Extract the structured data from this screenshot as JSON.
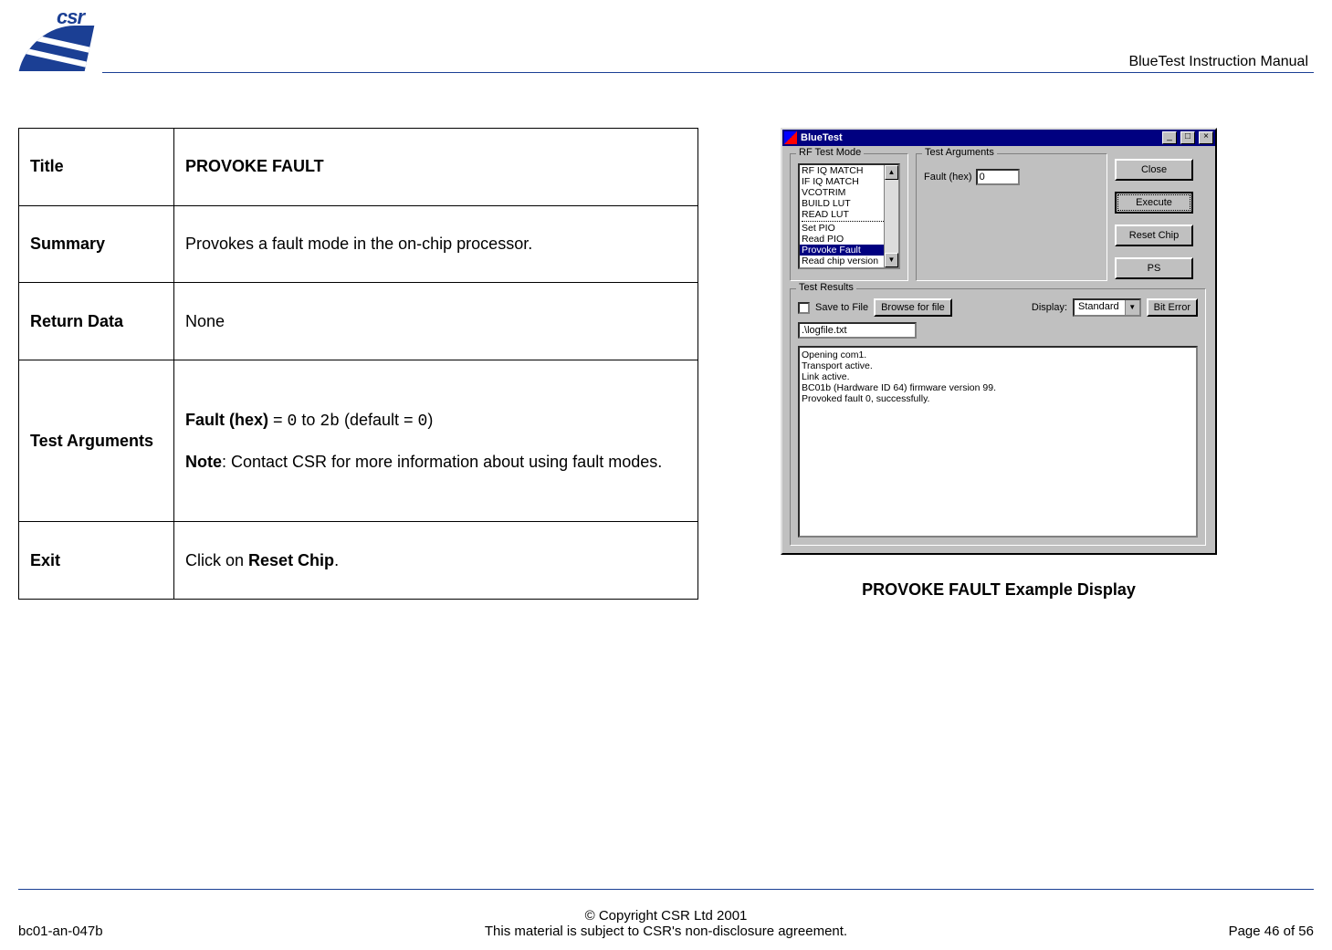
{
  "header": {
    "logo_text": "csr",
    "doc_title": "BlueTest Instruction Manual"
  },
  "table": {
    "rows": {
      "title": {
        "label": "Title",
        "value": "PROVOKE FAULT"
      },
      "summary": {
        "label": "Summary",
        "value": "Provokes a fault mode in the on-chip processor."
      },
      "return_data": {
        "label": "Return Data",
        "value": "None"
      },
      "test_args": {
        "label": "Test Arguments",
        "line1_pre": "Fault (hex)",
        "line1_mid": " = ",
        "c0": "0",
        "to": " to ",
        "c2b": "2b",
        "deflt": " (default = ",
        "c0b": "0",
        "close": ")",
        "note_label": "Note",
        "note_rest": ": Contact CSR for more information about using fault modes."
      },
      "exit": {
        "label": "Exit",
        "pre": "Click on ",
        "btn": "Reset Chip",
        "post": "."
      }
    }
  },
  "app": {
    "title": "BlueTest",
    "tbtn_min": "_",
    "tbtn_max": "□",
    "tbtn_close": "×",
    "groups": {
      "rf": "RF Test Mode",
      "args": "Test Arguments",
      "results": "Test Results"
    },
    "rf_items": {
      "i0": "RF IQ MATCH",
      "i1": "IF IQ MATCH",
      "i2": "VCOTRIM",
      "i3": "BUILD LUT",
      "i4": "READ LUT",
      "i5": "Set PIO",
      "i6": "Read PIO",
      "i7": "Provoke Fault",
      "i8": "Read chip version"
    },
    "scroll_up": "▲",
    "scroll_down": "▼",
    "args_label": "Fault (hex)",
    "args_value": "0",
    "buttons": {
      "close": "Close",
      "execute": "Execute",
      "reset": "Reset Chip",
      "ps": "PS"
    },
    "results": {
      "save_label": "Save to File",
      "browse": "Browse for file",
      "display_label": "Display:",
      "display_combo": "Standard",
      "biterror": "Bit Error",
      "path": ".\\logfile.txt"
    },
    "log": "Opening com1.\nTransport active.\nLink active.\nBC01b (Hardware ID 64) firmware version 99.\nProvoked fault 0, successfully."
  },
  "caption": "PROVOKE FAULT Example Display",
  "footer": {
    "left": "bc01-an-047b",
    "center_line1": "© Copyright CSR Ltd 2001",
    "center_line2": "This material is subject to CSR's non-disclosure agreement.",
    "right": "Page 46 of 56"
  }
}
